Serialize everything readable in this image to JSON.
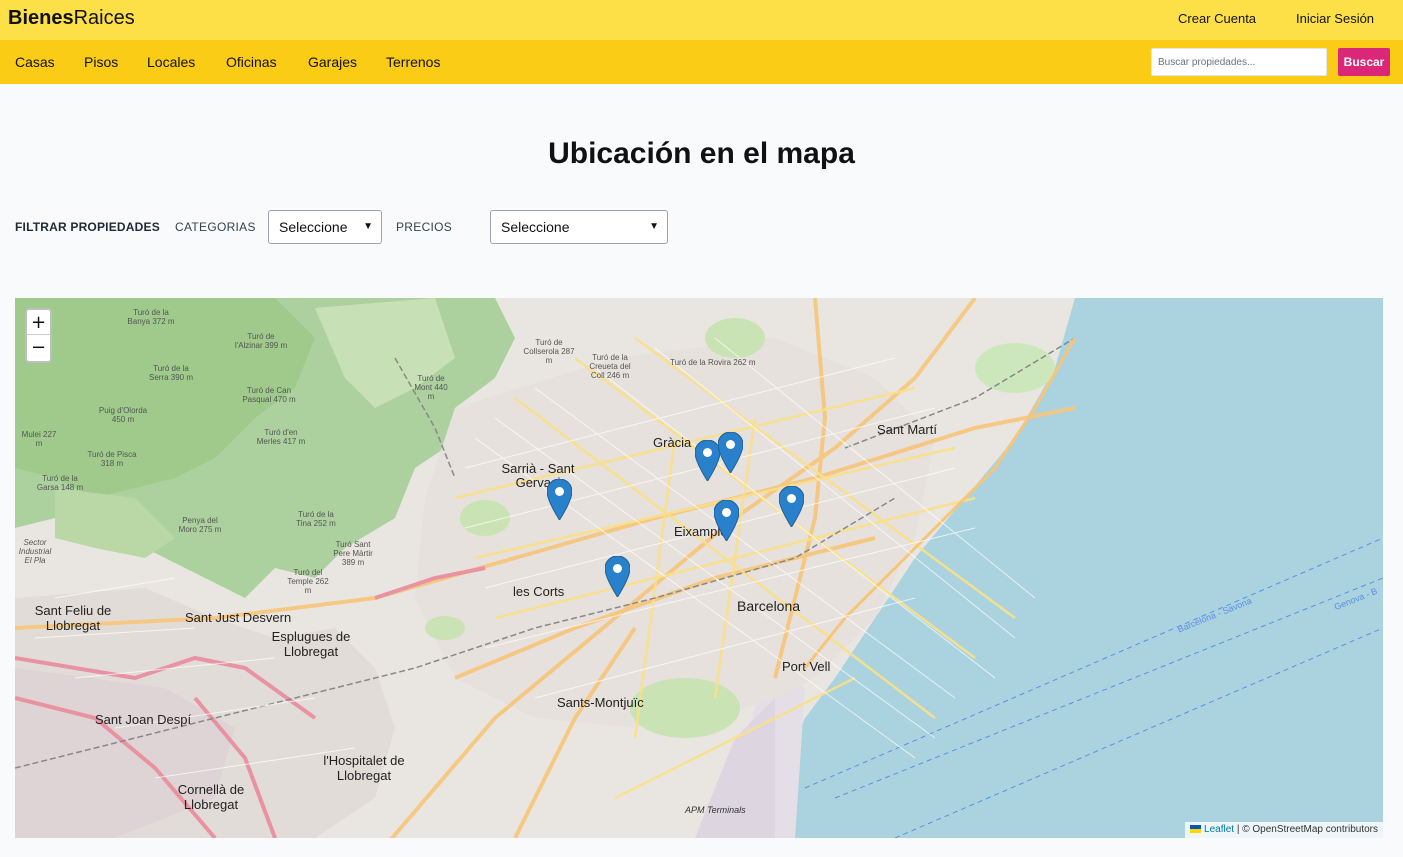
{
  "header": {
    "logo_bold": "Bienes",
    "logo_light": "Raices",
    "create_account": "Crear Cuenta",
    "login": "Iniciar Sesión"
  },
  "nav": {
    "items": [
      "Casas",
      "Pisos",
      "Locales",
      "Oficinas",
      "Garajes",
      "Terrenos"
    ],
    "search_placeholder": "Buscar propiedades...",
    "search_button": "Buscar"
  },
  "main": {
    "title": "Ubicación en el mapa",
    "filter_title": "FILTRAR PROPIEDADES",
    "categories_label": "CATEGORIAS",
    "categories_value": "Seleccione",
    "prices_label": "PRECIOS",
    "prices_value": "Seleccione"
  },
  "map": {
    "zoom_in": "+",
    "zoom_out": "−",
    "attribution_leaflet": "Leaflet",
    "attribution_rest": "| © OpenStreetMap contributors",
    "marker_count": 6,
    "labels": {
      "gracia": "Gràcia",
      "sarria": "Sarrià - Sant Gervasi",
      "eixample": "Eixample",
      "barcelona": "Barcelona",
      "les_corts": "les Corts",
      "sant_marti": "Sant Martí",
      "sants": "Sants-Montjuïc",
      "port_vell": "Port Vell",
      "sant_feliu": "Sant Feliu de Llobregat",
      "sant_just": "Sant Just Desvern",
      "esplugues": "Esplugues de Llobregat",
      "sant_joan": "Sant Joan Despí",
      "hospitalet": "l'Hospitalet de Llobregat",
      "cornella": "Cornellà de Llobregat",
      "apm": "APM Terminals",
      "barcelona_savona": "Barcelona - Savona",
      "genova": "Genova - B",
      "turo_rovira": "Turó de la Rovira 262 m",
      "turo_creueta": "Turó de la Creueta del Coll 246 m",
      "turo_collserola": "Turó de Collserola 287 m",
      "turo_mont": "Turó de Mont 440 m",
      "turo_merles": "Turó d'en Merles 417 m",
      "turo_pasqual": "Turó de Can Pasqual 470 m",
      "turo_alzinar": "Turó de l'Alzinar 399 m",
      "turo_banya": "Turó de la Banya 372 m",
      "puig_olorda": "Puig d'Olorda 450 m",
      "turo_serra": "Turó de la Serra 390 m",
      "turo_pisco": "Turó de Pisca 318 m",
      "turo_garsa": "Turó de la Garsa 148 m",
      "penya_moro": "Penya del Moro 275 m",
      "turo_tina": "Turó de la Tina 252 m",
      "turo_pere": "Turó Sant Pere Màrtir 389 m",
      "turo_temple": "Turó del Temple 262 m",
      "mulei": "Mulei 227 m",
      "sector": "Sector Industrial El Pla"
    }
  }
}
